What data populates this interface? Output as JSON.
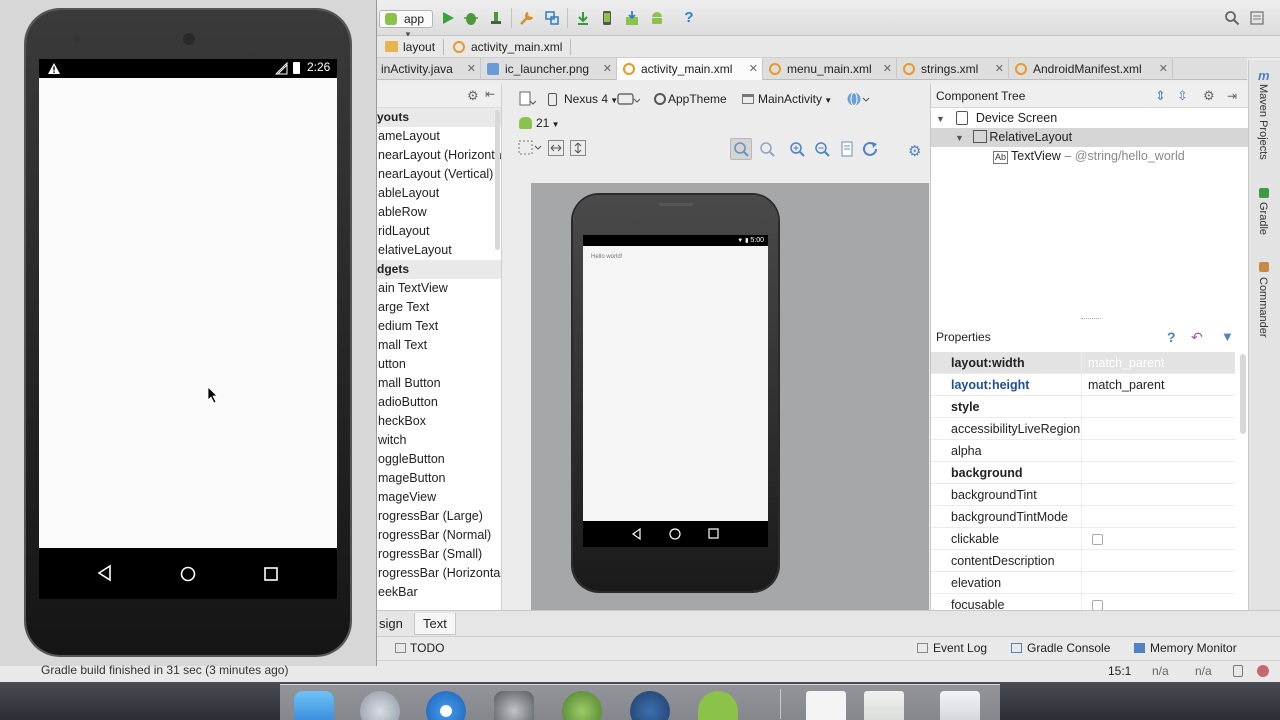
{
  "toolbar": {
    "module": "app"
  },
  "breadcrumbs": [
    "layout",
    "activity_main.xml"
  ],
  "tabs": [
    {
      "label": "inActivity.java",
      "active": false
    },
    {
      "label": "ic_launcher.png",
      "active": false
    },
    {
      "label": "activity_main.xml",
      "active": true
    },
    {
      "label": "menu_main.xml",
      "active": false
    },
    {
      "label": "strings.xml",
      "active": false
    },
    {
      "label": "AndroidManifest.xml",
      "active": false
    }
  ],
  "palette": {
    "items": [
      {
        "label": "youts",
        "section": true
      },
      {
        "label": "ameLayout"
      },
      {
        "label": "nearLayout (Horizonta"
      },
      {
        "label": "nearLayout (Vertical)"
      },
      {
        "label": "ableLayout"
      },
      {
        "label": "ableRow"
      },
      {
        "label": "ridLayout"
      },
      {
        "label": "elativeLayout"
      },
      {
        "label": "dgets",
        "section": true
      },
      {
        "label": "ain TextView"
      },
      {
        "label": "arge Text"
      },
      {
        "label": "edium Text"
      },
      {
        "label": "mall Text"
      },
      {
        "label": "utton"
      },
      {
        "label": "mall Button"
      },
      {
        "label": "adioButton"
      },
      {
        "label": "heckBox"
      },
      {
        "label": "witch"
      },
      {
        "label": "oggleButton"
      },
      {
        "label": "mageButton"
      },
      {
        "label": "mageView"
      },
      {
        "label": "rogressBar (Large)"
      },
      {
        "label": "rogressBar (Normal)"
      },
      {
        "label": "rogressBar (Small)"
      },
      {
        "label": "rogressBar (Horizonta"
      },
      {
        "label": "eekBar"
      }
    ]
  },
  "editor_toolbar": {
    "device": "Nexus 4",
    "theme": "AppTheme",
    "activity": "MainActivity",
    "api": "21"
  },
  "preview": {
    "time": "5:00",
    "text": "Hello world!"
  },
  "component_tree": {
    "title": "Component Tree",
    "items": [
      {
        "label": "Device Screen",
        "detail": ""
      },
      {
        "label": "RelativeLayout",
        "detail": ""
      },
      {
        "label": "TextView",
        "detail": " – @string/hello_world"
      }
    ]
  },
  "properties": {
    "title": "Properties",
    "rows": [
      {
        "name": "layout:width",
        "value": "match_parent"
      },
      {
        "name": "layout:height",
        "value": "match_parent"
      },
      {
        "name": "style",
        "value": ""
      },
      {
        "name": "accessibilityLiveRegion",
        "value": ""
      },
      {
        "name": "alpha",
        "value": ""
      },
      {
        "name": "background",
        "value": ""
      },
      {
        "name": "backgroundTint",
        "value": ""
      },
      {
        "name": "backgroundTintMode",
        "value": ""
      },
      {
        "name": "clickable",
        "value": ""
      },
      {
        "name": "contentDescription",
        "value": ""
      },
      {
        "name": "elevation",
        "value": ""
      },
      {
        "name": "focusable",
        "value": ""
      }
    ]
  },
  "side_tools": [
    "Maven Projects",
    "Gradle",
    "Commander"
  ],
  "bottom_tabs": {
    "design": "sign",
    "text": "Text"
  },
  "tool_windows": {
    "todo": "TODO",
    "event_log": "Event Log",
    "gradle_console": "Gradle Console",
    "memory_monitor": "Memory Monitor"
  },
  "status": {
    "message": "Gradle build finished in 31 sec (3 minutes ago)",
    "position": "15:1",
    "na1": "n/a",
    "na2": "n/a"
  },
  "emulator": {
    "time": "2:26"
  },
  "colors": {
    "accent_blue": "#1f6fc7",
    "android_green": "#8bc34a",
    "selection": "#d6d6d6"
  }
}
